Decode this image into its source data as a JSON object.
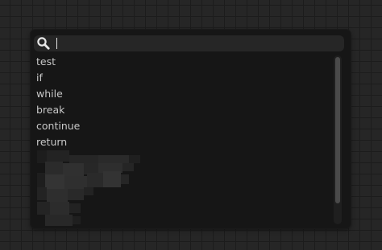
{
  "search": {
    "value": "",
    "icon": "search-icon"
  },
  "items": [
    {
      "label": "test"
    },
    {
      "label": "if"
    },
    {
      "label": "while"
    },
    {
      "label": "break"
    },
    {
      "label": "continue"
    },
    {
      "label": "return"
    },
    {
      "label": ""
    },
    {
      "label": ""
    },
    {
      "label": ""
    },
    {
      "label": ""
    },
    {
      "label": ""
    }
  ],
  "colors": {
    "canvas": "#262626",
    "grid": "#1c1c1c",
    "popup": "#161616",
    "search_bar": "#262626",
    "item_text": "#c8c8c8",
    "scroll_thumb": "#4a4a4a"
  }
}
